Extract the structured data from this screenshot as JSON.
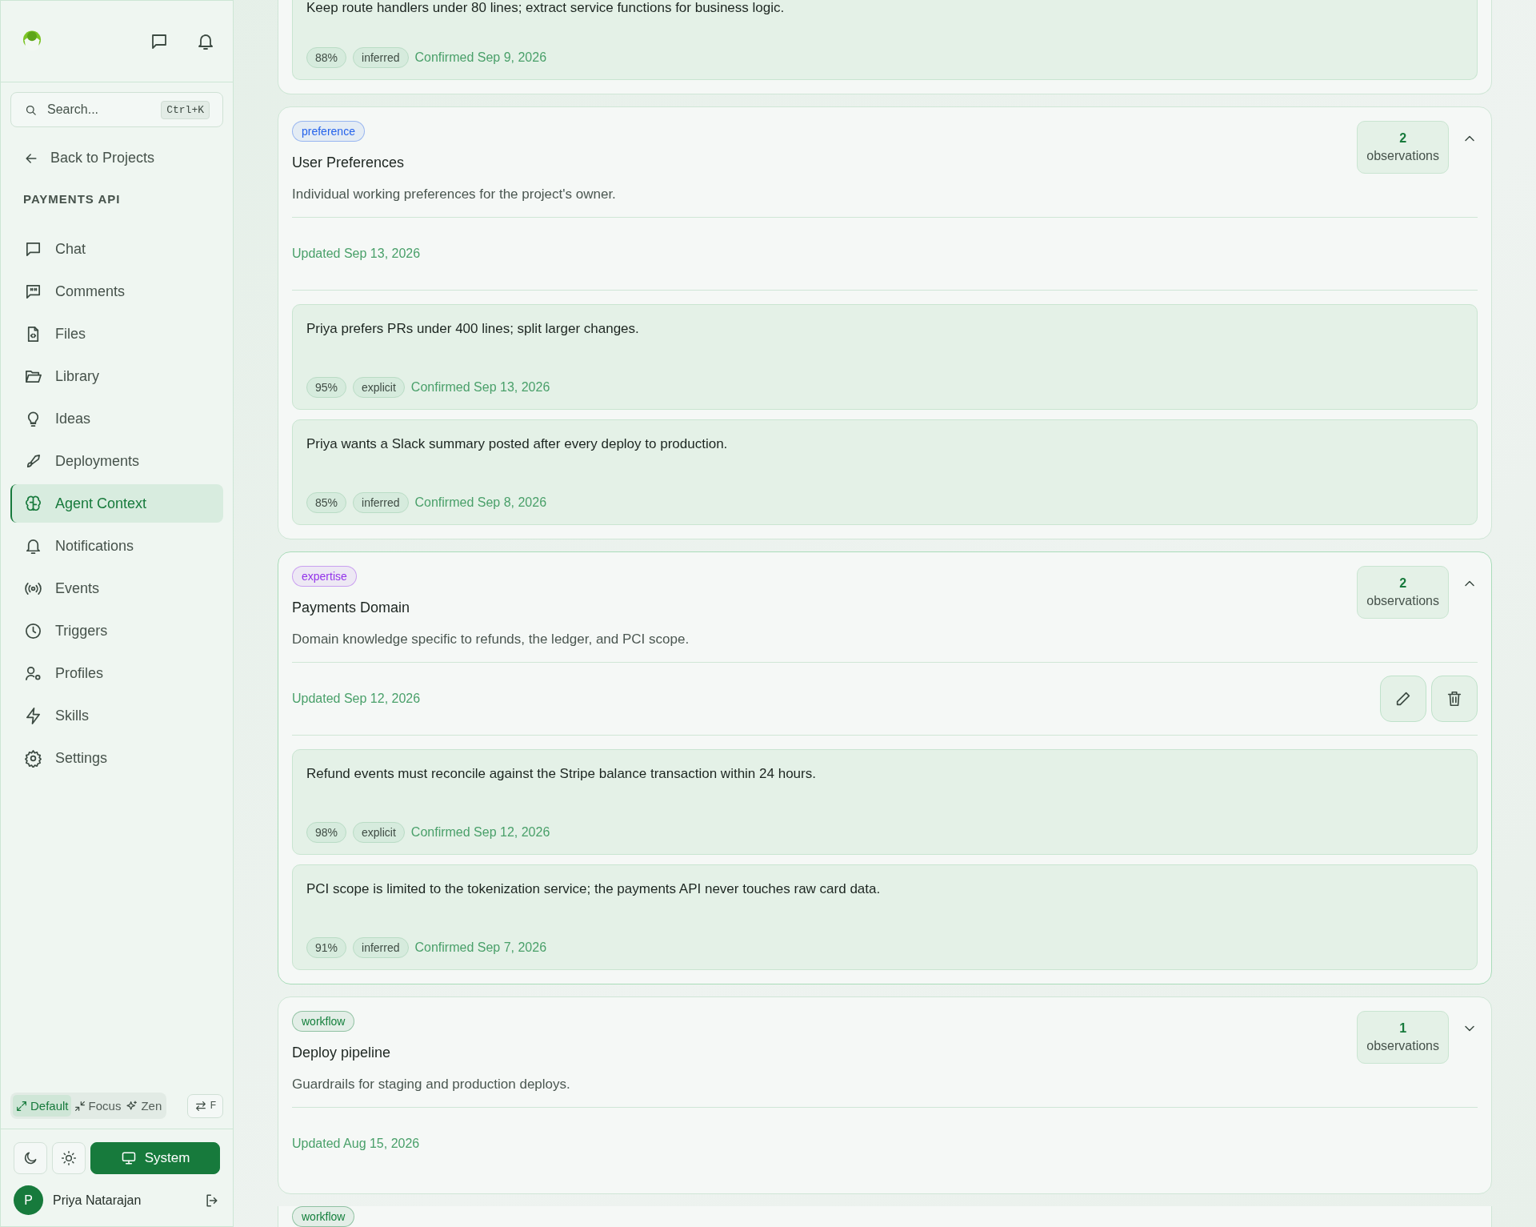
{
  "sidebar": {
    "search": {
      "placeholder": "Search...",
      "shortcut": "Ctrl+K"
    },
    "back_link": "Back to Projects",
    "project": "PAYMENTS API",
    "nav": [
      {
        "label": "Chat",
        "selected": false
      },
      {
        "label": "Comments",
        "selected": false
      },
      {
        "label": "Files",
        "selected": false
      },
      {
        "label": "Library",
        "selected": false
      },
      {
        "label": "Ideas",
        "selected": false
      },
      {
        "label": "Deployments",
        "selected": false
      },
      {
        "label": "Agent Context",
        "selected": true
      },
      {
        "label": "Notifications",
        "selected": false
      },
      {
        "label": "Events",
        "selected": false
      },
      {
        "label": "Triggers",
        "selected": false
      },
      {
        "label": "Profiles",
        "selected": false
      },
      {
        "label": "Skills",
        "selected": false
      },
      {
        "label": "Settings",
        "selected": false
      }
    ],
    "layout_modes": [
      {
        "label": "Default",
        "selected": true
      },
      {
        "label": "Focus",
        "selected": false
      },
      {
        "label": "Zen",
        "selected": false
      }
    ],
    "swap_button": "F",
    "themes": [
      {
        "kind": "dark",
        "selected": false
      },
      {
        "kind": "light",
        "selected": false
      },
      {
        "kind": "system",
        "label": "System",
        "selected": true
      }
    ],
    "user": {
      "initial": "P",
      "name": "Priya Natarajan"
    }
  },
  "groups": [
    {
      "observations": [
        {
          "text": "Keep route handlers under 80 lines; extract service functions for business logic.",
          "confidence": "88%",
          "source": "inferred",
          "confirmed": "Confirmed Sep 9, 2026"
        }
      ]
    },
    {
      "tag": "preference",
      "color": "#2563eb",
      "title": "User Preferences",
      "description": "Individual working preferences for the project's owner.",
      "updated": "Updated Sep 13, 2026",
      "count": "2",
      "count_label": "observations",
      "expanded": true,
      "show_actions": false,
      "observations": [
        {
          "text": "Priya prefers PRs under 400 lines; split larger changes.",
          "confidence": "95%",
          "source": "explicit",
          "confirmed": "Confirmed Sep 13, 2026"
        },
        {
          "text": "Priya wants a Slack summary posted after every deploy to production.",
          "confidence": "85%",
          "source": "inferred",
          "confirmed": "Confirmed Sep 8, 2026"
        }
      ]
    },
    {
      "tag": "expertise",
      "color": "#9333ea",
      "title": "Payments Domain",
      "description": "Domain knowledge specific to refunds, the ledger, and PCI scope.",
      "updated": "Updated Sep 12, 2026",
      "count": "2",
      "count_label": "observations",
      "expanded": true,
      "show_actions": true,
      "observations": [
        {
          "text": "Refund events must reconcile against the Stripe balance transaction within 24 hours.",
          "confidence": "98%",
          "source": "explicit",
          "confirmed": "Confirmed Sep 12, 2026"
        },
        {
          "text": "PCI scope is limited to the tokenization service; the payments API never touches raw card data.",
          "confidence": "91%",
          "source": "inferred",
          "confirmed": "Confirmed Sep 7, 2026"
        }
      ]
    },
    {
      "tag": "workflow",
      "color": "#15803d",
      "title": "Deploy pipeline",
      "description": "Guardrails for staging and production deploys.",
      "updated": "Updated Aug 15, 2026",
      "count": "1",
      "count_label": "observations",
      "expanded": false,
      "show_actions": false
    },
    {
      "tag": "workflow",
      "color": "#15803d"
    }
  ]
}
